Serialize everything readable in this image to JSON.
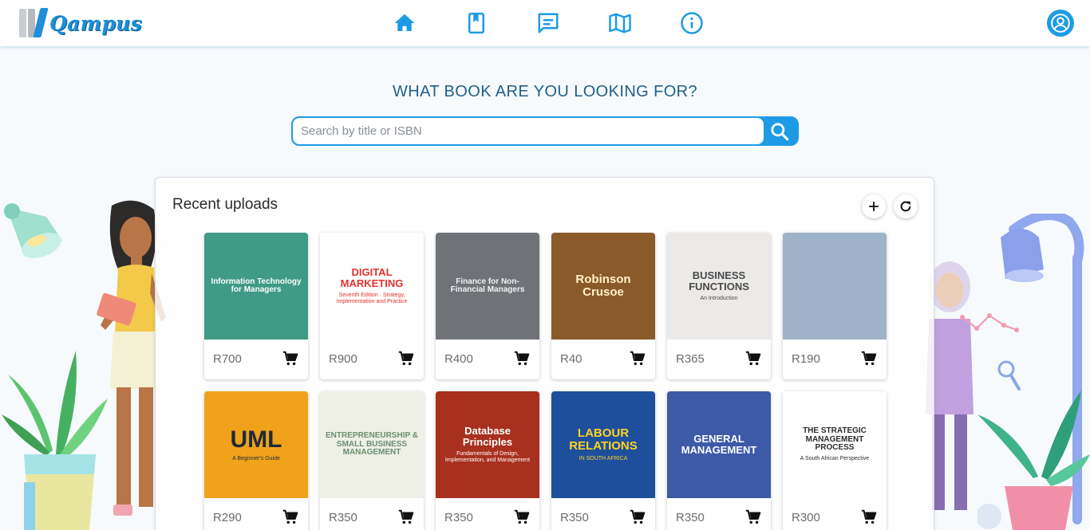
{
  "app": {
    "name": "Qampus"
  },
  "nav": {
    "items": [
      {
        "name": "home",
        "icon": "home-icon",
        "active": true
      },
      {
        "name": "books",
        "icon": "bookmark-book-icon"
      },
      {
        "name": "messages",
        "icon": "message-icon"
      },
      {
        "name": "map",
        "icon": "map-icon"
      },
      {
        "name": "about",
        "icon": "info-icon"
      }
    ],
    "profile_icon": "user-circle-icon"
  },
  "search": {
    "heading": "WHAT BOOK ARE YOU LOOKING FOR?",
    "placeholder": "Search by title or ISBN",
    "value": ""
  },
  "recent": {
    "title": "Recent uploads",
    "add_icon": "plus-icon",
    "refresh_icon": "refresh-icon",
    "books": [
      {
        "cover_title": "Information Technology for Managers",
        "cover_sub": "",
        "price": "R700",
        "cover_bg": "#3f9a86",
        "cover_fg": "#ffffff"
      },
      {
        "cover_title": "DIGITAL MARKETING",
        "cover_sub": "Seventh Edition · Strategy, Implementation and Practice",
        "price": "R900",
        "cover_bg": "#ffffff",
        "cover_fg": "#e3312d"
      },
      {
        "cover_title": "Finance for Non-Financial Managers",
        "cover_sub": "",
        "price": "R400",
        "cover_bg": "#6f7378",
        "cover_fg": "#f1f1f1"
      },
      {
        "cover_title": "Robinson Crusoe",
        "cover_sub": "",
        "price": "R40",
        "cover_bg": "#8a5a2b",
        "cover_fg": "#fff3c8"
      },
      {
        "cover_title": "BUSINESS FUNCTIONS",
        "cover_sub": "An Introduction",
        "price": "R365",
        "cover_bg": "#eceae8",
        "cover_fg": "#4a4a4a"
      },
      {
        "cover_title": "",
        "cover_sub": "",
        "price": "R190",
        "cover_bg": "#9fb3c8",
        "cover_fg": "#1b2a3a"
      },
      {
        "cover_title": "UML",
        "cover_sub": "A Beginner's Guide",
        "price": "R290",
        "cover_bg": "#f0a21a",
        "cover_fg": "#1d2b3a"
      },
      {
        "cover_title": "ENTREPRENEURSHIP & SMALL BUSINESS MANAGEMENT",
        "cover_sub": "",
        "price": "R350",
        "cover_bg": "#eef0e6",
        "cover_fg": "#6a8f6c"
      },
      {
        "cover_title": "Database Principles",
        "cover_sub": "Fundamentals of Design, Implementation, and Management",
        "price": "R350",
        "cover_bg": "#a8301f",
        "cover_fg": "#ffffff"
      },
      {
        "cover_title": "LABOUR RELATIONS",
        "cover_sub": "IN SOUTH AFRICA",
        "price": "R350",
        "cover_bg": "#1e4f9c",
        "cover_fg": "#ffd21f"
      },
      {
        "cover_title": "GENERAL MANAGEMENT",
        "cover_sub": "",
        "price": "R350",
        "cover_bg": "#3c5aa8",
        "cover_fg": "#ffffff"
      },
      {
        "cover_title": "THE STRATEGIC MANAGEMENT PROCESS",
        "cover_sub": "A South African Perspective",
        "price": "R300",
        "cover_bg": "#ffffff",
        "cover_fg": "#2b2b2b"
      }
    ]
  },
  "colors": {
    "accent": "#1e9be5",
    "heading": "#1f5f8b"
  }
}
